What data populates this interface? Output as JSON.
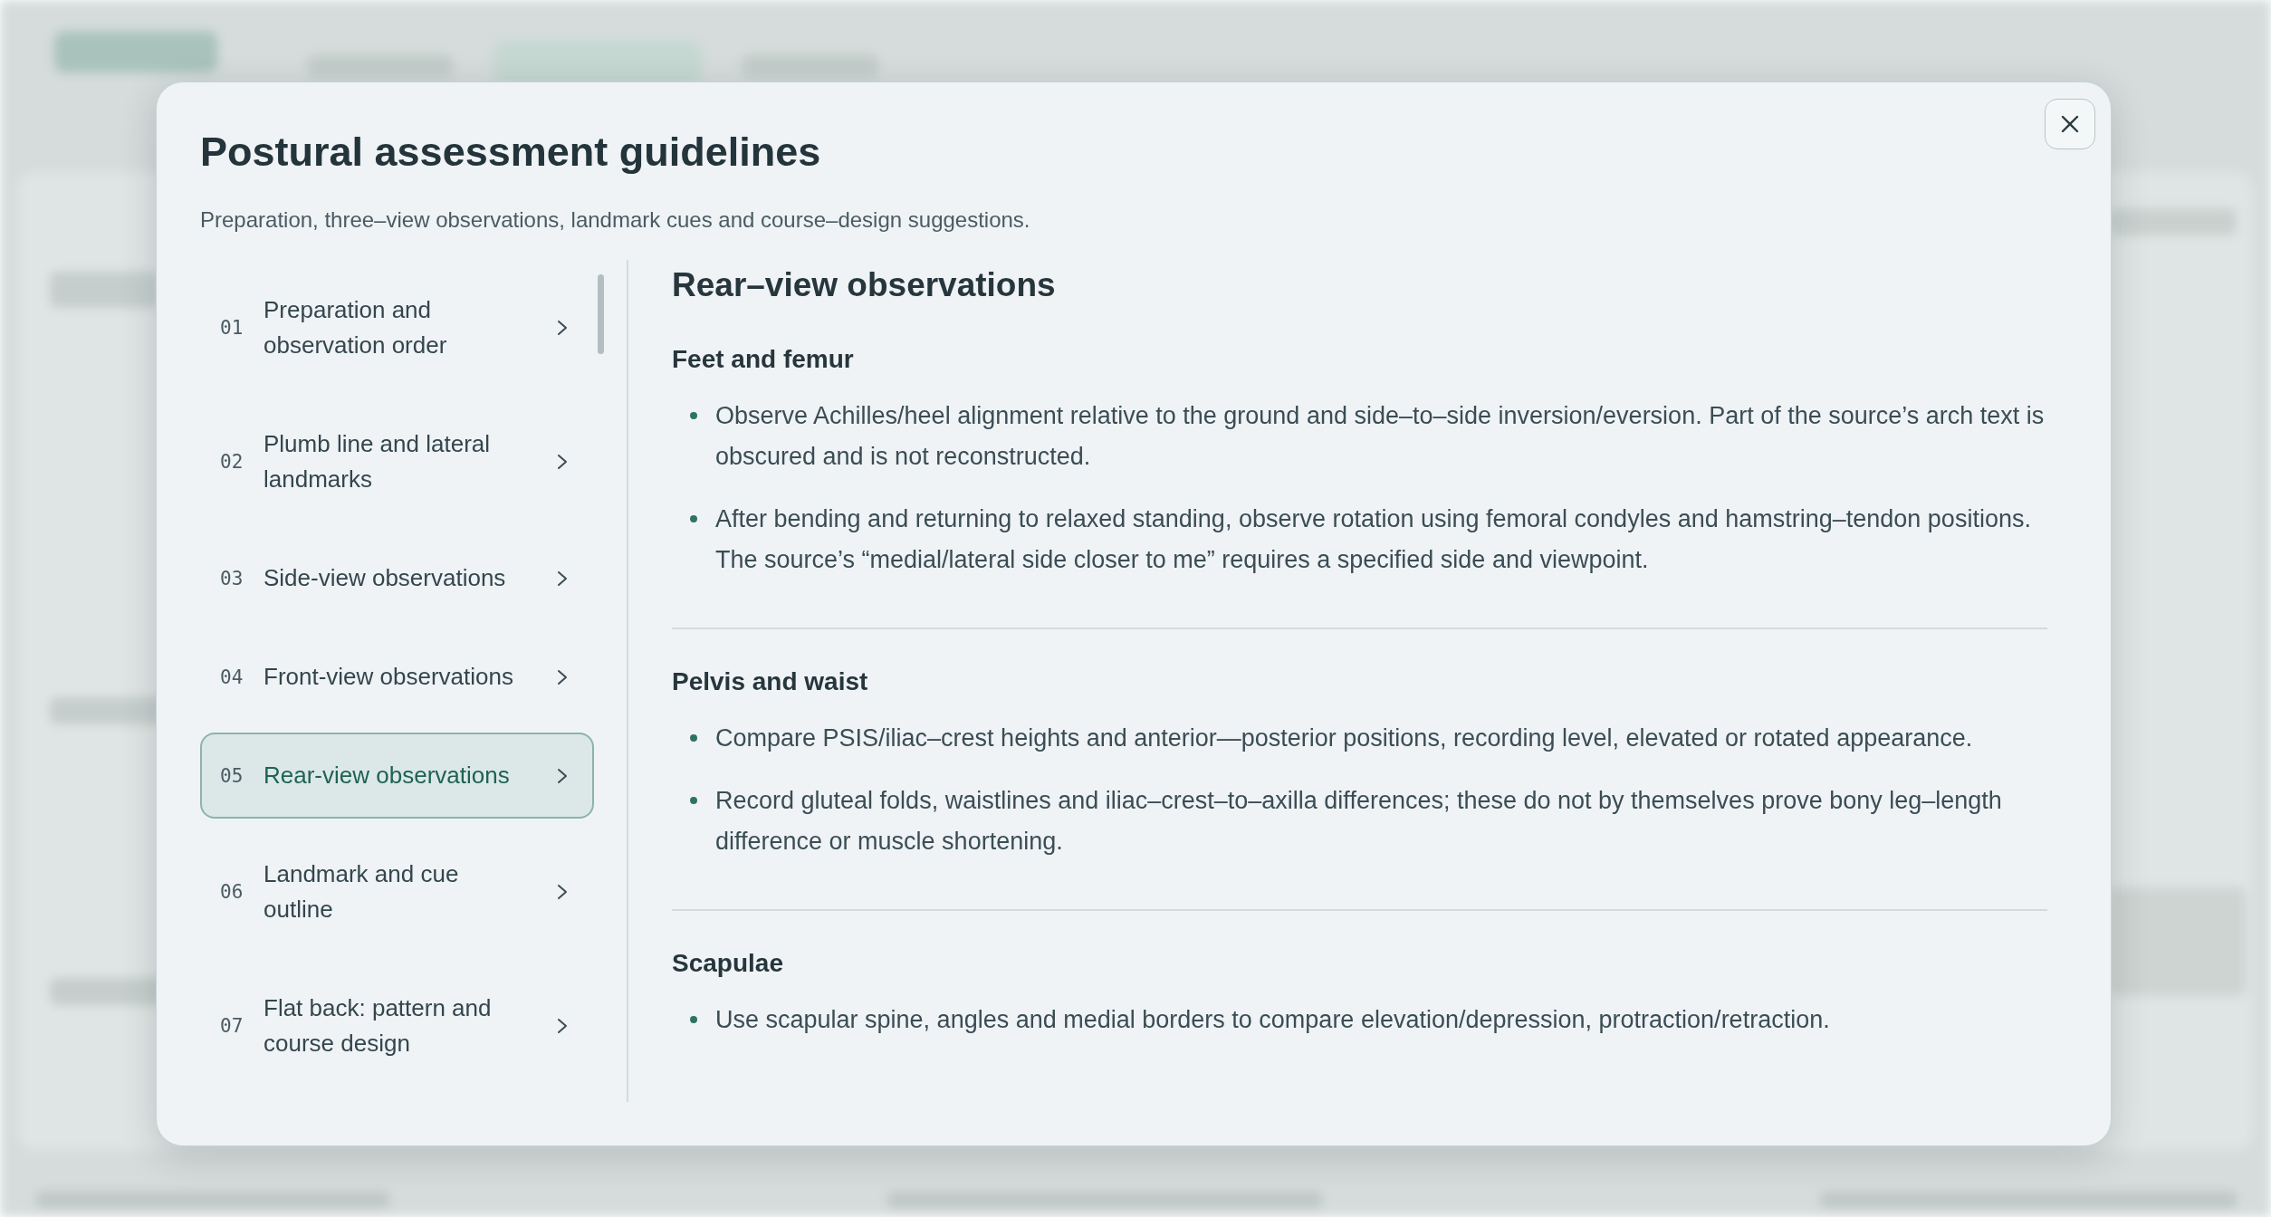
{
  "dialog": {
    "title": "Postural assessment guidelines",
    "subtitle": "Preparation, three–view observations, landmark cues and course–design suggestions."
  },
  "nav": [
    {
      "number": "01",
      "label": "Preparation and observation order",
      "selected": false
    },
    {
      "number": "02",
      "label": "Plumb line and lateral landmarks",
      "selected": false
    },
    {
      "number": "03",
      "label": "Side-view observations",
      "selected": false
    },
    {
      "number": "04",
      "label": "Front-view observations",
      "selected": false
    },
    {
      "number": "05",
      "label": "Rear-view observations",
      "selected": true
    },
    {
      "number": "06",
      "label": "Landmark and cue outline",
      "selected": false
    },
    {
      "number": "07",
      "label": "Flat back: pattern and course design",
      "selected": false
    }
  ],
  "content": {
    "title": "Rear–view observations",
    "sections": [
      {
        "heading": "Feet and femur",
        "bullets": [
          "Observe Achilles/heel alignment relative to the ground and side–to–side inversion/eversion. Part of the source’s arch text is obscured and is not reconstructed.",
          "After bending and returning to relaxed standing, observe rotation using femoral condyles and hamstring–tendon positions. The source’s “medial/lateral side closer to me” requires a specified side and viewpoint."
        ]
      },
      {
        "heading": "Pelvis and waist",
        "bullets": [
          "Compare PSIS/iliac–crest heights and anterior—posterior positions, recording level, elevated or rotated appearance.",
          "Record gluteal folds, waistlines and iliac–crest–to–axilla differences; these do not by themselves prove bony leg–length difference or muscle shortening."
        ]
      },
      {
        "heading": "Scapulae",
        "bullets": [
          "Use scapular spine, angles and medial borders to compare elevation/depression, protraction/retraction."
        ]
      }
    ]
  }
}
